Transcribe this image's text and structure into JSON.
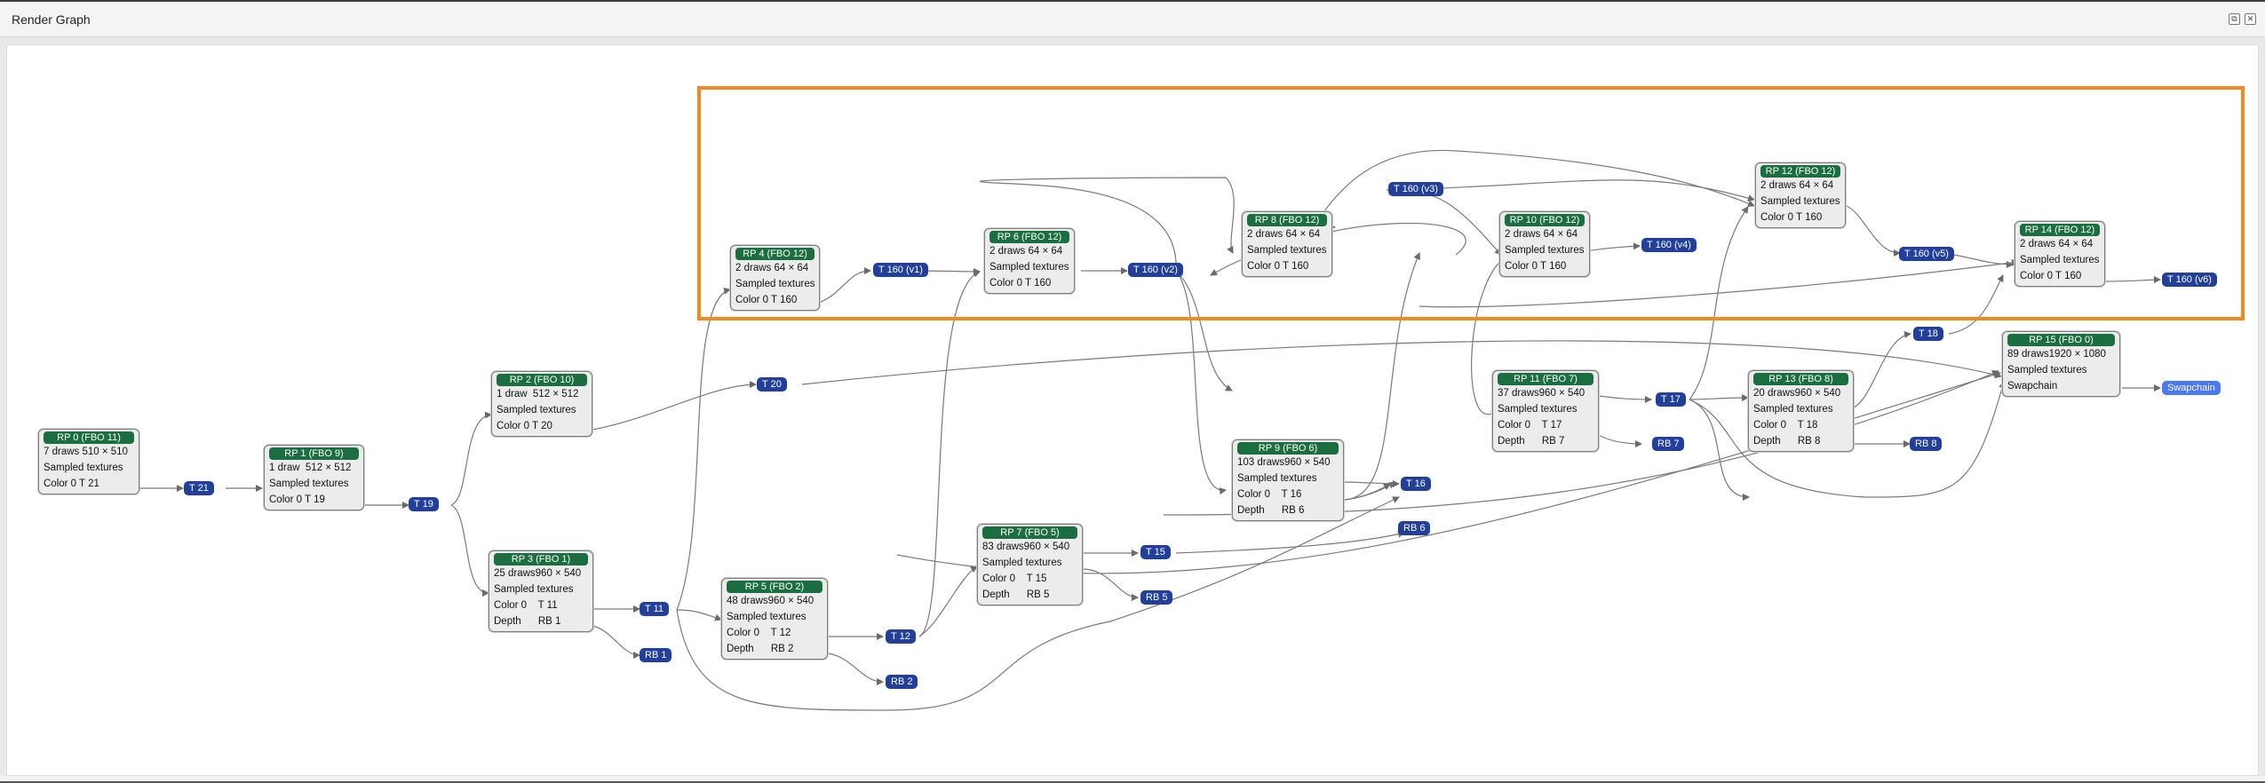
{
  "window": {
    "title": "Render Graph"
  },
  "nodes": [
    {
      "id": "rp0",
      "header": "RP 0 (FBO 11)",
      "lines": [
        "7 draws 510 × 510",
        "Sampled textures",
        "Color 0 T 21"
      ]
    },
    {
      "id": "rp1",
      "header": "RP 1 (FBO 9)",
      "lines": [
        "1 draw  512 × 512",
        "Sampled textures",
        "Color 0 T 19"
      ]
    },
    {
      "id": "rp2",
      "header": "RP 2 (FBO 10)",
      "lines": [
        "1 draw  512 × 512",
        "Sampled textures",
        "Color 0 T 20"
      ]
    },
    {
      "id": "rp3",
      "header": "RP 3 (FBO 1)",
      "lines": [
        "25 draws960 × 540",
        "Sampled textures",
        "Color 0    T 11",
        "Depth      RB 1"
      ]
    },
    {
      "id": "rp4",
      "header": "RP 4 (FBO 12)",
      "lines": [
        "2 draws 64 × 64",
        "Sampled textures",
        "Color 0 T 160"
      ]
    },
    {
      "id": "rp5",
      "header": "RP 5 (FBO 2)",
      "lines": [
        "48 draws960 × 540",
        "Sampled textures",
        "Color 0    T 12",
        "Depth      RB 2"
      ]
    },
    {
      "id": "rp6",
      "header": "RP 6 (FBO 12)",
      "lines": [
        "2 draws 64 × 64",
        "Sampled textures",
        "Color 0 T 160"
      ]
    },
    {
      "id": "rp7",
      "header": "RP 7 (FBO 5)",
      "lines": [
        "83 draws960 × 540",
        "Sampled textures",
        "Color 0    T 15",
        "Depth      RB 5"
      ]
    },
    {
      "id": "rp8",
      "header": "RP 8 (FBO 12)",
      "lines": [
        "2 draws 64 × 64",
        "Sampled textures",
        "Color 0 T 160"
      ]
    },
    {
      "id": "rp9",
      "header": "RP 9 (FBO 6)",
      "lines": [
        "103 draws960 × 540",
        "Sampled textures",
        "Color 0    T 16",
        "Depth      RB 6"
      ]
    },
    {
      "id": "rp10",
      "header": "RP 10 (FBO 12)",
      "lines": [
        "2 draws 64 × 64",
        "Sampled textures",
        "Color 0 T 160"
      ]
    },
    {
      "id": "rp11",
      "header": "RP 11 (FBO 7)",
      "lines": [
        "37 draws960 × 540",
        "Sampled textures",
        "Color 0    T 17",
        "Depth      RB 7"
      ]
    },
    {
      "id": "rp12",
      "header": "RP 12 (FBO 12)",
      "lines": [
        "2 draws 64 × 64",
        "Sampled textures",
        "Color 0 T 160"
      ]
    },
    {
      "id": "rp13",
      "header": "RP 13 (FBO 8)",
      "lines": [
        "20 draws960 × 540",
        "Sampled textures",
        "Color 0    T 18",
        "Depth      RB 8"
      ]
    },
    {
      "id": "rp14",
      "header": "RP 14 (FBO 12)",
      "lines": [
        "2 draws 64 × 64",
        "Sampled textures",
        "Color 0 T 160"
      ]
    },
    {
      "id": "rp15",
      "header": "RP 15 (FBO 0)",
      "lines": [
        "89 draws1920 × 1080",
        "Sampled textures",
        "Swapchain"
      ]
    }
  ],
  "resources": [
    {
      "id": "t21",
      "label": "T 21"
    },
    {
      "id": "t19",
      "label": "T 19"
    },
    {
      "id": "t20",
      "label": "T 20"
    },
    {
      "id": "t11",
      "label": "T 11"
    },
    {
      "id": "rb1",
      "label": "RB 1"
    },
    {
      "id": "t160v1",
      "label": "T 160 (v1)"
    },
    {
      "id": "t12",
      "label": "T 12"
    },
    {
      "id": "rb2",
      "label": "RB 2"
    },
    {
      "id": "t160v2",
      "label": "T 160 (v2)"
    },
    {
      "id": "t15",
      "label": "T 15"
    },
    {
      "id": "rb5",
      "label": "RB 5"
    },
    {
      "id": "t160v3",
      "label": "T 160 (v3)"
    },
    {
      "id": "t16",
      "label": "T 16"
    },
    {
      "id": "rb6",
      "label": "RB 6"
    },
    {
      "id": "t160v4",
      "label": "T 160 (v4)"
    },
    {
      "id": "t17",
      "label": "T 17"
    },
    {
      "id": "rb7",
      "label": "RB 7"
    },
    {
      "id": "t160v5",
      "label": "T 160 (v5)"
    },
    {
      "id": "t18",
      "label": "T 18"
    },
    {
      "id": "rb8",
      "label": "RB 8"
    },
    {
      "id": "t160v6",
      "label": "T 160 (v6)"
    },
    {
      "id": "swapchain",
      "label": "Swapchain"
    }
  ],
  "colors": {
    "pass_header": "#1b6e3f",
    "resource": "#22409a",
    "swapchain": "#4a78ee",
    "highlight": "#f28a23",
    "edge": "#707070"
  }
}
